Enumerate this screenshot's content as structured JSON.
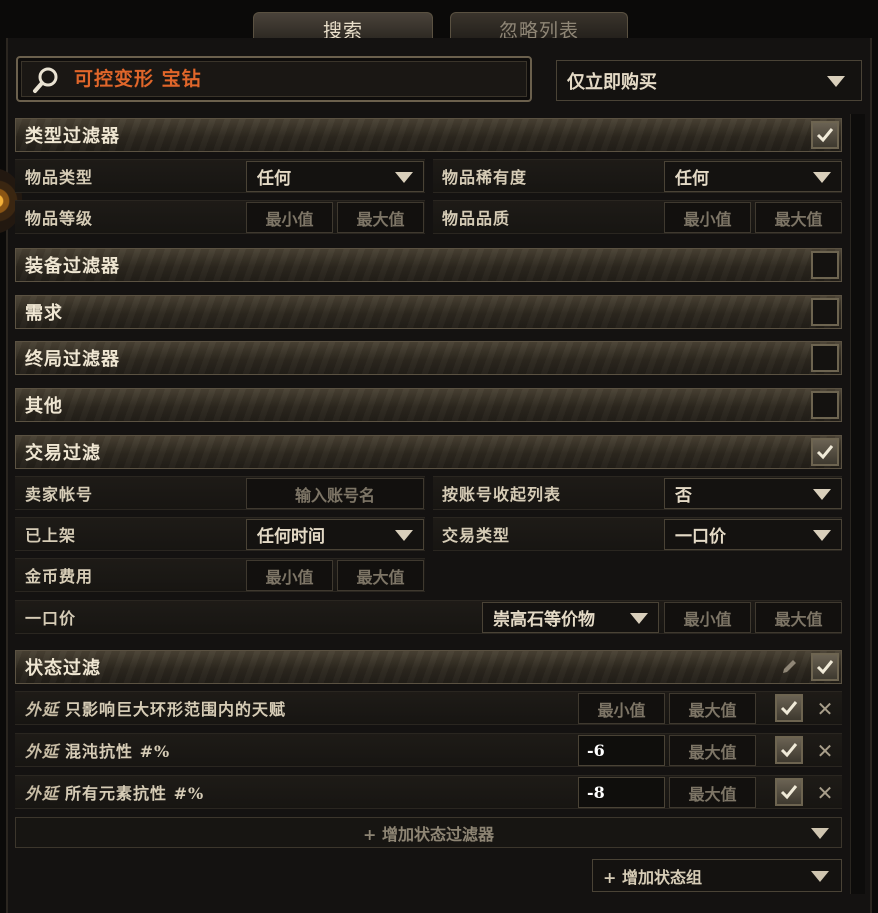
{
  "tabs": [
    {
      "label": "搜索",
      "active": true
    },
    {
      "label": "忽略列表",
      "active": false
    }
  ],
  "search": {
    "value": "可控变形 宝钻",
    "icon": "search-icon",
    "buy_mode": "仅立即购买"
  },
  "sections": {
    "type_filters": {
      "title": "类型过滤器",
      "checked": true
    },
    "equipment_filters": {
      "title": "装备过滤器",
      "checked": false
    },
    "requirements": {
      "title": "需求",
      "checked": false
    },
    "endgame_filters": {
      "title": "终局过滤器",
      "checked": false
    },
    "misc": {
      "title": "其他",
      "checked": false
    },
    "trade_filters": {
      "title": "交易过滤",
      "checked": true
    },
    "stat_filters": {
      "title": "状态过滤",
      "checked": true
    }
  },
  "type_filters": {
    "item_category_label": "物品类型",
    "item_category_value": "任何",
    "item_rarity_label": "物品稀有度",
    "item_rarity_value": "任何",
    "item_level_label": "物品等级",
    "item_quality_label": "物品品质",
    "min_placeholder": "最小值",
    "max_placeholder": "最大值"
  },
  "trade_filters": {
    "seller_label": "卖家帐号",
    "seller_placeholder": "输入账号名",
    "collapse_label": "按账号收起列表",
    "collapse_value": "否",
    "listed_label": "已上架",
    "listed_value": "任何时间",
    "sale_type_label": "交易类型",
    "sale_type_value": "一口价",
    "gold_fee_label": "金币费用",
    "price_label": "一口价",
    "price_currency": "崇高石等价物",
    "min_placeholder": "最小值",
    "max_placeholder": "最大值"
  },
  "stats": [
    {
      "prefix": "外延",
      "text": "只影响巨大环形范围内的天赋",
      "min": "",
      "max": "",
      "checked": true
    },
    {
      "prefix": "外延",
      "text": "混沌抗性 #%",
      "min": "-6",
      "max": "",
      "checked": true
    },
    {
      "prefix": "外延",
      "text": "所有元素抗性 #%",
      "min": "-8",
      "max": "",
      "checked": true
    }
  ],
  "stat_placeholders": {
    "min": "最小值",
    "max": "最大值"
  },
  "add_stat_filter": "+ 增加状态过滤器",
  "add_stat_group": "+ 增加状态组",
  "colors": {
    "search_text": "#e0662a",
    "accent_gold": "#6d6450",
    "background": "#141211"
  }
}
